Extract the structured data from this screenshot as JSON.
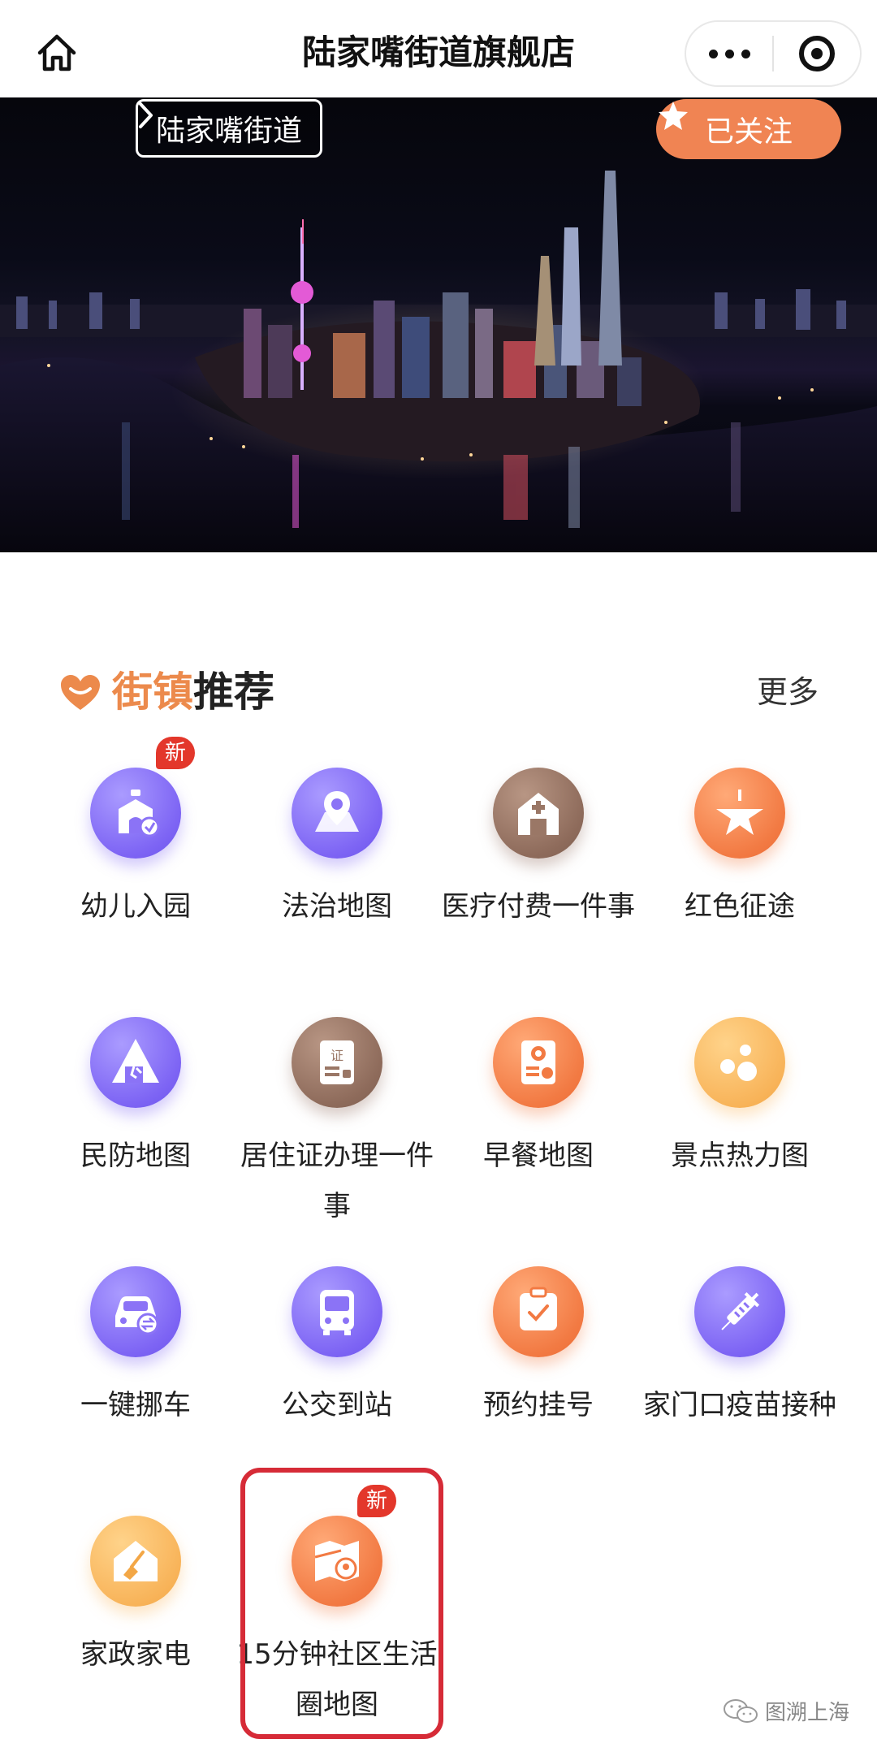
{
  "header": {
    "title": "陆家嘴街道旗舰店",
    "home_icon": "home-icon",
    "more_icon": "more-dots-icon",
    "close_icon": "target-icon"
  },
  "banner": {
    "street_link": "陆家嘴街道",
    "follow_label": "已关注",
    "image": "Lujiazui night skyline photo"
  },
  "section": {
    "title_part1": "街镇",
    "title_part2": "推荐",
    "more": "更多",
    "accent_color": "#ec8a4c"
  },
  "services": [
    {
      "label": "幼儿入园",
      "icon": "kindergarten-icon",
      "color": "purple",
      "badge": "新"
    },
    {
      "label": "法治地图",
      "icon": "map-pin-icon",
      "color": "purple"
    },
    {
      "label": "医疗付费一件事",
      "icon": "hospital-icon",
      "color": "brown"
    },
    {
      "label": "红色征途",
      "icon": "star-flag-icon",
      "color": "orange"
    },
    {
      "label": "民防地图",
      "icon": "shelter-icon",
      "color": "purple"
    },
    {
      "label": "居住证办理一件事",
      "icon": "certificate-icon",
      "color": "brown"
    },
    {
      "label": "早餐地图",
      "icon": "breakfast-icon",
      "color": "orange"
    },
    {
      "label": "景点热力图",
      "icon": "heatmap-dots-icon",
      "color": "yellow"
    },
    {
      "label": "一键挪车",
      "icon": "car-move-icon",
      "color": "purple"
    },
    {
      "label": "公交到站",
      "icon": "bus-icon",
      "color": "purple"
    },
    {
      "label": "预约挂号",
      "icon": "clipboard-check-icon",
      "color": "orange"
    },
    {
      "label": "家门口疫苗接种",
      "icon": "syringe-icon",
      "color": "purple"
    },
    {
      "label": "家政家电",
      "icon": "house-broom-icon",
      "color": "yellow"
    },
    {
      "label": "15分钟社区生活圈地图",
      "icon": "map-location-icon",
      "color": "orange",
      "badge": "新"
    }
  ],
  "watermark": "图溯上海",
  "colors": {
    "purple": "#7d64f4",
    "brown": "#8e6b5b",
    "orange": "#f27a43",
    "yellow": "#f8b45a",
    "badge": "#e3372b",
    "highlight": "#d62b37"
  }
}
